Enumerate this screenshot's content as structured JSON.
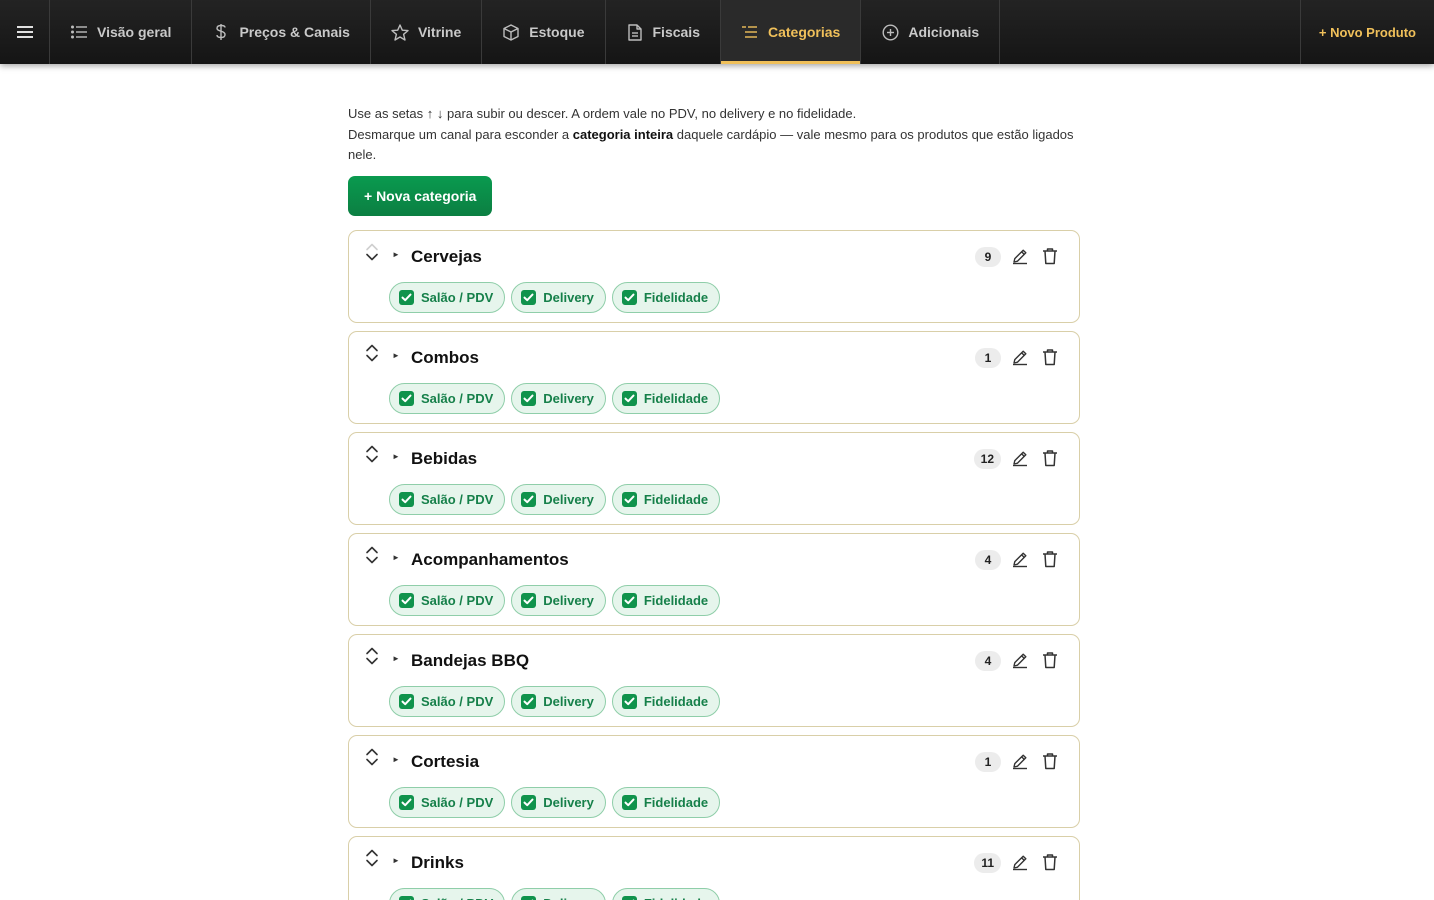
{
  "topbar": {
    "tabs": [
      {
        "label": "Visão geral",
        "icon": "list-icon",
        "active": false
      },
      {
        "label": "Preços & Canais",
        "icon": "dollar-icon",
        "active": false
      },
      {
        "label": "Vitrine",
        "icon": "star-icon",
        "active": false
      },
      {
        "label": "Estoque",
        "icon": "box-icon",
        "active": false
      },
      {
        "label": "Fiscais",
        "icon": "document-icon",
        "active": false
      },
      {
        "label": "Categorias",
        "icon": "categories-list-icon",
        "active": true
      },
      {
        "label": "Adicionais",
        "icon": "plus-circle-icon",
        "active": false
      }
    ],
    "new_product_label": "+ Novo Produto",
    "accent_color": "#f0c05a"
  },
  "help": {
    "line1": "Use as setas ↑ ↓ para subir ou descer. A ordem vale no PDV, no delivery e no fidelidade.",
    "line2_before": "Desmarque um canal para esconder a ",
    "line2_bold": "categoria inteira",
    "line2_after": " daquele cardápio — vale mesmo para os produtos que estão ligados nele."
  },
  "new_category_label": "+ Nova categoria",
  "channels": [
    "Salão / PDV",
    "Delivery",
    "Fidelidade"
  ],
  "categories": [
    {
      "name": "Cervejas",
      "count": "9",
      "channels_checked": [
        true,
        true,
        true
      ]
    },
    {
      "name": "Combos",
      "count": "1",
      "channels_checked": [
        true,
        true,
        true
      ]
    },
    {
      "name": "Bebidas",
      "count": "12",
      "channels_checked": [
        true,
        true,
        true
      ]
    },
    {
      "name": "Acompanhamentos",
      "count": "4",
      "channels_checked": [
        true,
        true,
        true
      ]
    },
    {
      "name": "Bandejas BBQ",
      "count": "4",
      "channels_checked": [
        true,
        true,
        true
      ]
    },
    {
      "name": "Cortesia",
      "count": "1",
      "channels_checked": [
        true,
        true,
        true
      ]
    },
    {
      "name": "Drinks",
      "count": "11",
      "channels_checked": [
        true,
        true,
        true
      ]
    }
  ],
  "colors": {
    "green": "#10934c",
    "card_border": "#d9cfa8"
  }
}
